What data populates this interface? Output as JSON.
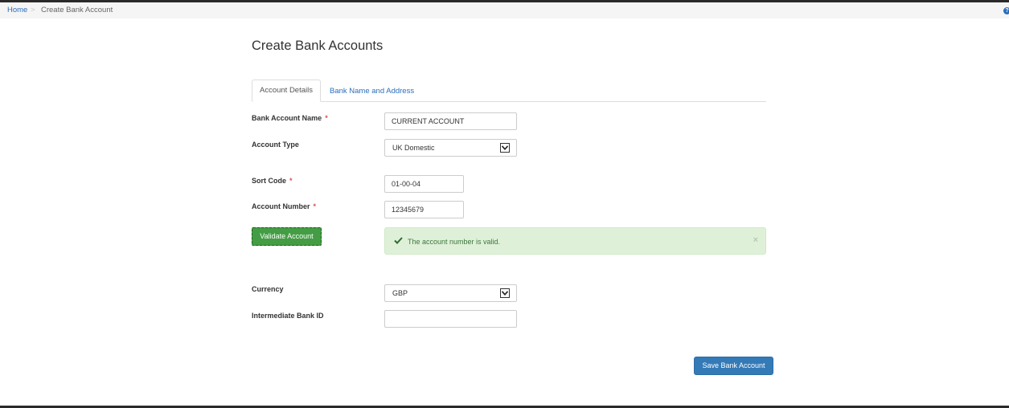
{
  "breadcrumb": {
    "home": "Home",
    "separator": ">",
    "current": "Create Bank Account",
    "help_icon": "?"
  },
  "page": {
    "title": "Create Bank Accounts"
  },
  "tabs": [
    {
      "label": "Account Details",
      "active": true
    },
    {
      "label": "Bank Name and Address",
      "active": false
    }
  ],
  "form": {
    "required_marker": "*",
    "bank_account_name": {
      "label": "Bank Account Name",
      "value": "CURRENT ACCOUNT"
    },
    "account_type": {
      "label": "Account Type",
      "value": "UK Domestic"
    },
    "sort_code": {
      "label": "Sort Code",
      "value": "01-00-04"
    },
    "account_number": {
      "label": "Account Number",
      "value": "12345679"
    },
    "currency": {
      "label": "Currency",
      "value": "GBP"
    },
    "intermediate_bank_id": {
      "label": "Intermediate Bank ID",
      "value": ""
    }
  },
  "validate_button": "Validate Account",
  "alert": {
    "message": "The account number is valid.",
    "close": "×",
    "type": "success"
  },
  "save_button": "Save Bank Account",
  "colors": {
    "link": "#2a6ebb",
    "success_bg": "#dff0d8",
    "success_text": "#3c763d",
    "validate_btn": "#449d44",
    "primary_btn": "#337ab7",
    "required": "#d9534f"
  }
}
